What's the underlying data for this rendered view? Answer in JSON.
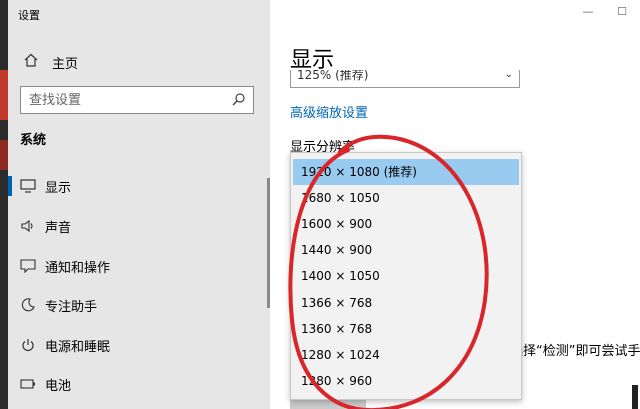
{
  "window": {
    "title": "设置",
    "minimize_glyph": "—",
    "maximize_glyph": "☐"
  },
  "sidebar": {
    "home_label": "主页",
    "search_placeholder": "查找设置",
    "section_title": "系统",
    "items": [
      {
        "label": "显示",
        "icon": "monitor-icon",
        "selected": true
      },
      {
        "label": "声音",
        "icon": "speaker-icon"
      },
      {
        "label": "通知和操作",
        "icon": "notification-icon"
      },
      {
        "label": "专注助手",
        "icon": "moon-icon"
      },
      {
        "label": "电源和睡眠",
        "icon": "power-icon"
      },
      {
        "label": "电池",
        "icon": "battery-icon"
      }
    ]
  },
  "main": {
    "title": "显示",
    "scale_value": "125% (推荐)",
    "advanced_scaling_link": "高级缩放设置",
    "resolution_label": "显示分辨率",
    "detect_hint_fragment": "选择“检测”即可尝试手动"
  },
  "resolution_dropdown": {
    "options": [
      "1920 × 1080 (推荐)",
      "1680 × 1050",
      "1600 × 900",
      "1440 × 900",
      "1400 × 1050",
      "1366 × 768",
      "1360 × 768",
      "1280 × 1024",
      "1280 × 960"
    ],
    "selected_index": 0
  },
  "colors": {
    "accent": "#0063b1",
    "selected_option": "#99cbf1",
    "annotation": "#d9262a"
  }
}
